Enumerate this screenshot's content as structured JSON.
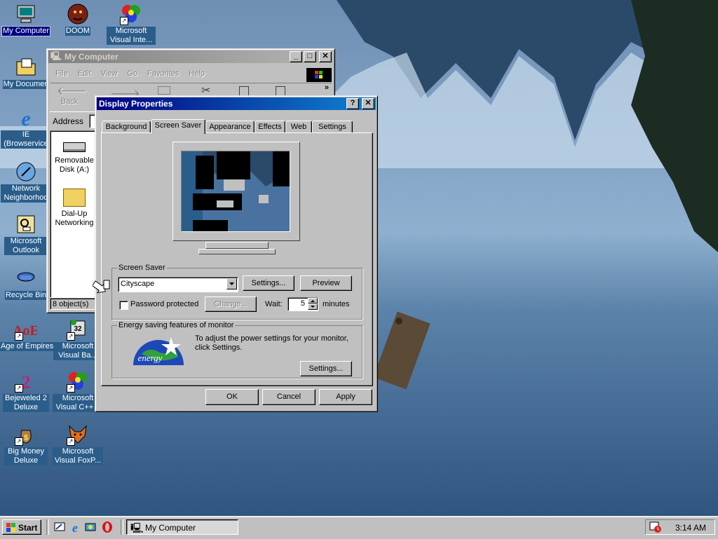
{
  "desktop": {
    "icons": [
      {
        "label": "My Computer"
      },
      {
        "label": "DOOM"
      },
      {
        "label": "Microsoft Visual Inte..."
      },
      {
        "label": "My Documen"
      },
      {
        "label": "IE (Browservice"
      },
      {
        "label": "Network Neighborhoo"
      },
      {
        "label": "Microsoft Outlook"
      },
      {
        "label": "Recycle Bin"
      },
      {
        "label": "Age of Empires"
      },
      {
        "label": "Microsoft Visual Ba..."
      },
      {
        "label": "Bejeweled 2 Deluxe"
      },
      {
        "label": "Microsoft Visual C++ 6"
      },
      {
        "label": "Big Money Deluxe"
      },
      {
        "label": "Microsoft Visual FoxP..."
      }
    ]
  },
  "explorer": {
    "title": "My Computer",
    "menu": [
      "File",
      "Edit",
      "View",
      "Go",
      "Favorites",
      "Help"
    ],
    "toolbar": {
      "back": "Back"
    },
    "address_label": "Address",
    "items": [
      {
        "label": "Removable Disk (A:)"
      },
      {
        "label": "Dial-Up Networking"
      }
    ],
    "status": "8 object(s)"
  },
  "display_properties": {
    "title": "Display Properties",
    "help": "?",
    "close": "✕",
    "tabs": [
      "Background",
      "Screen Saver",
      "Appearance",
      "Effects",
      "Web",
      "Settings"
    ],
    "active_tab": "Screen Saver",
    "screen_saver": {
      "group_label": "Screen Saver",
      "selected": "Cityscape",
      "settings_btn": "Settings...",
      "preview_btn": "Preview",
      "password_label": "Password protected",
      "password_checked": false,
      "change_btn": "Change...",
      "wait_label": "Wait:",
      "wait_value": "5",
      "minutes_label": "minutes"
    },
    "energy": {
      "group_label": "Energy saving features of monitor",
      "logo_text": "energy",
      "description": "To adjust the power settings for your monitor, click Settings.",
      "settings_btn": "Settings..."
    },
    "buttons": {
      "ok": "OK",
      "cancel": "Cancel",
      "apply": "Apply"
    }
  },
  "taskbar": {
    "start": "Start",
    "task": "My Computer",
    "clock": "3:14 AM"
  },
  "colors": {
    "titlebar_active": "#000080",
    "face": "#c0c0c0",
    "desktop_sky": "#4a6f95"
  }
}
